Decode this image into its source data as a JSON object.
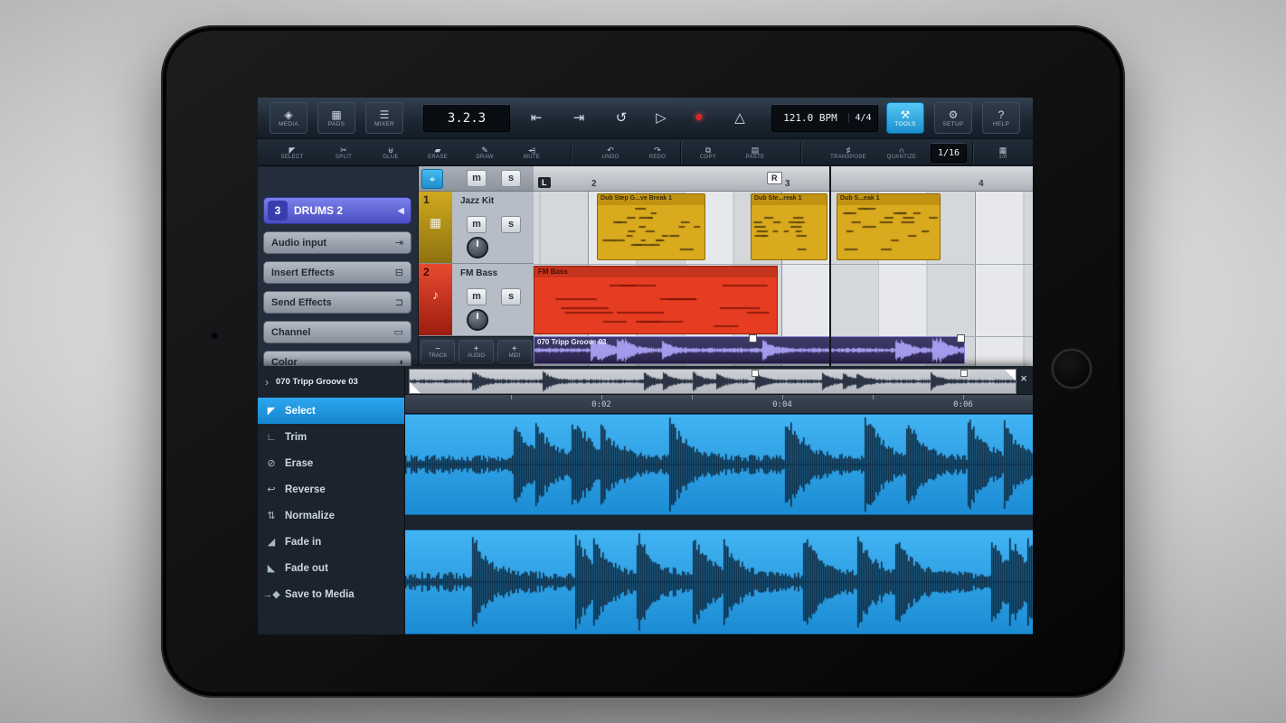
{
  "toolbar": {
    "media": "MEDIA",
    "pads": "PADS",
    "mixer": "MIXER",
    "time_display": "3.2.3",
    "bpm_value": "121.0 BPM",
    "time_signature": "4/4",
    "tools": "TOOLS",
    "setup": "SETUP",
    "help": "HELP"
  },
  "edit_toolbar": {
    "select": "SELECT",
    "split": "SPLIT",
    "glue": "GLUE",
    "erase": "ERASE",
    "draw": "DRAW",
    "mute": "MUTE",
    "undo": "UNDO",
    "redo": "REDO",
    "copy": "COPY",
    "paste": "PASTE",
    "transpose": "TRANSPOSE",
    "quantize": "QUANTIZE",
    "quantize_value": "1/16",
    "grid_value": "1/8"
  },
  "inspector": {
    "track_number": "3",
    "track_name": "DRUMS 2",
    "items": [
      {
        "label": "Audio input"
      },
      {
        "label": "Insert Effects"
      },
      {
        "label": "Send Effects"
      },
      {
        "label": "Channel"
      },
      {
        "label": "Color"
      }
    ]
  },
  "track_list": {
    "header": {
      "mute": "m",
      "solo": "s"
    },
    "tracks": [
      {
        "number": "1",
        "name": "Jazz Kit",
        "mute": "m",
        "solo": "s"
      },
      {
        "number": "2",
        "name": "FM Bass",
        "mute": "m",
        "solo": "s"
      }
    ],
    "add_buttons": {
      "track": "TRACK",
      "audio": "AUDIO",
      "midi": "MIDI"
    }
  },
  "ruler": {
    "marks": [
      "2",
      "3",
      "4"
    ],
    "left_locator": "L",
    "right_locator": "R"
  },
  "arrangement": {
    "clips": [
      {
        "name": "Dub Step G...ve Break 1"
      },
      {
        "name": "Dub Ste...reak 1"
      },
      {
        "name": "Dub S...eak 1"
      }
    ],
    "bass_clip": "FM Bass",
    "audio_clip": "070 Tripp Groove 03"
  },
  "editor": {
    "title": "070 Tripp Groove 03",
    "timeline": [
      "0:02",
      "0:04",
      "0:06"
    ],
    "tools": [
      {
        "label": "Select",
        "icon": "◤",
        "selected": true
      },
      {
        "label": "Trim",
        "icon": "∟"
      },
      {
        "label": "Erase",
        "icon": "⊘"
      },
      {
        "label": "Reverse",
        "icon": "↩"
      },
      {
        "label": "Normalize",
        "icon": "⇅"
      },
      {
        "label": "Fade in",
        "icon": "◢"
      },
      {
        "label": "Fade out",
        "icon": "◣"
      },
      {
        "label": "Save to Media",
        "icon": "→◆"
      }
    ],
    "close_icon": "×",
    "collapse_icon": "›"
  },
  "icons": {
    "media": "◈",
    "pads": "▦",
    "mixer": "☰",
    "skip_start": "⇤",
    "skip_end": "⇥",
    "loop": "↺",
    "play": "▷",
    "record": "●",
    "metronome": "△",
    "tools": "⚒",
    "setup": "⚙",
    "help": "?",
    "select": "◤",
    "split": "✂",
    "glue": "⊎",
    "erase": "▰",
    "draw": "✎",
    "mute": "◁",
    "undo": "↶",
    "redo": "↷",
    "copy": "⧉",
    "paste": "▤",
    "transpose": "♯",
    "quantize": "∩",
    "grid": "▦",
    "follow": "⌖",
    "audio_input": "⇥",
    "insert_effects": "⊟",
    "send_effects": "⊐",
    "channel": "▭",
    "color": "◑",
    "inspector_back": "◀",
    "drums_track": "▦",
    "bass_track": "♪",
    "minus": "−",
    "plus": "+"
  },
  "colors": {
    "tools_active": "#1c90cf",
    "record_red": "#e02525",
    "drums_track": "#cfa91f",
    "bass_track": "#e84a30",
    "midi_clip": "#d9a91e",
    "bass_clip": "#e63d22",
    "audio_clip": "#2c2750",
    "waveform_bg": "#1b8cd4",
    "editor_selected": "#1485cd"
  }
}
